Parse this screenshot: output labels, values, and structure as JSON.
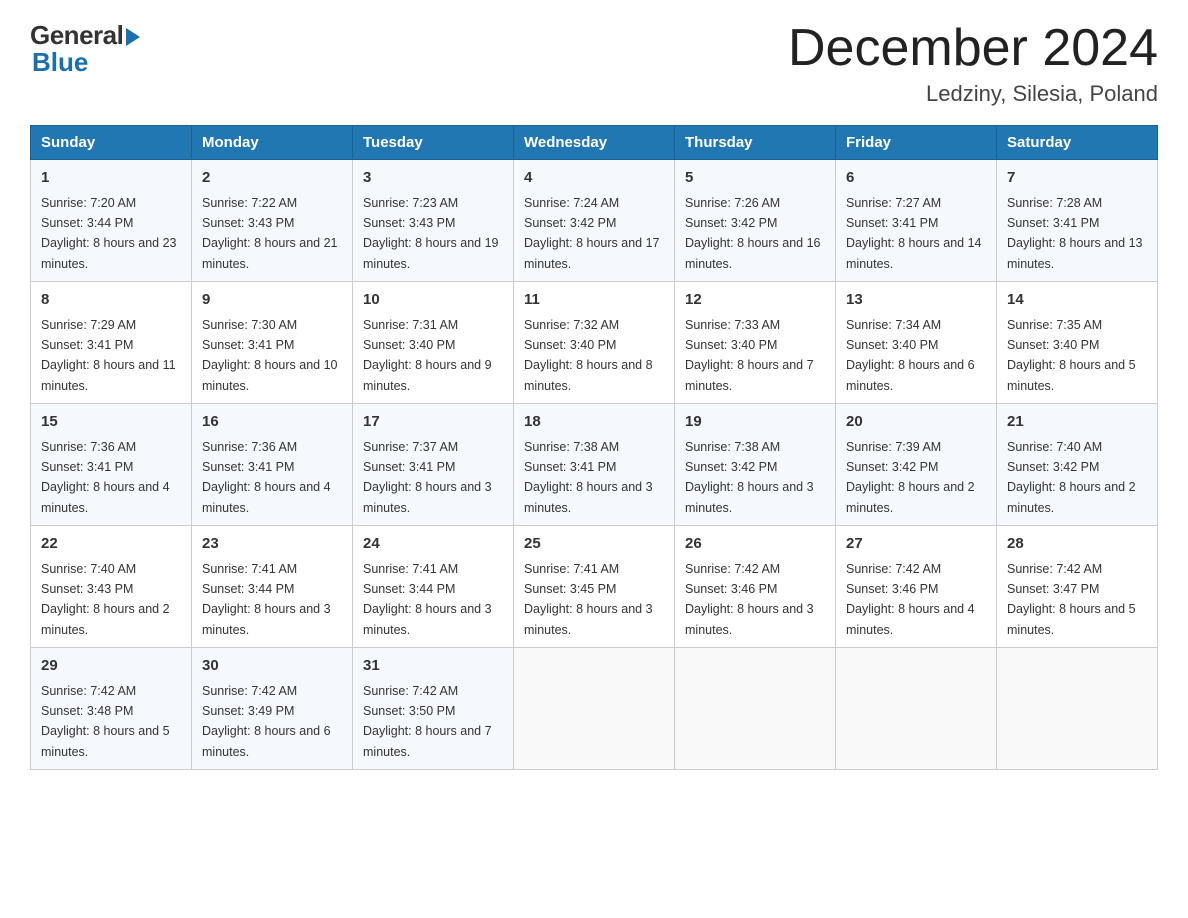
{
  "header": {
    "logo_general": "General",
    "logo_blue": "Blue",
    "month_year": "December 2024",
    "location": "Ledziny, Silesia, Poland"
  },
  "weekdays": [
    "Sunday",
    "Monday",
    "Tuesday",
    "Wednesday",
    "Thursday",
    "Friday",
    "Saturday"
  ],
  "weeks": [
    [
      {
        "day": "1",
        "sunrise": "7:20 AM",
        "sunset": "3:44 PM",
        "daylight": "8 hours and 23 minutes."
      },
      {
        "day": "2",
        "sunrise": "7:22 AM",
        "sunset": "3:43 PM",
        "daylight": "8 hours and 21 minutes."
      },
      {
        "day": "3",
        "sunrise": "7:23 AM",
        "sunset": "3:43 PM",
        "daylight": "8 hours and 19 minutes."
      },
      {
        "day": "4",
        "sunrise": "7:24 AM",
        "sunset": "3:42 PM",
        "daylight": "8 hours and 17 minutes."
      },
      {
        "day": "5",
        "sunrise": "7:26 AM",
        "sunset": "3:42 PM",
        "daylight": "8 hours and 16 minutes."
      },
      {
        "day": "6",
        "sunrise": "7:27 AM",
        "sunset": "3:41 PM",
        "daylight": "8 hours and 14 minutes."
      },
      {
        "day": "7",
        "sunrise": "7:28 AM",
        "sunset": "3:41 PM",
        "daylight": "8 hours and 13 minutes."
      }
    ],
    [
      {
        "day": "8",
        "sunrise": "7:29 AM",
        "sunset": "3:41 PM",
        "daylight": "8 hours and 11 minutes."
      },
      {
        "day": "9",
        "sunrise": "7:30 AM",
        "sunset": "3:41 PM",
        "daylight": "8 hours and 10 minutes."
      },
      {
        "day": "10",
        "sunrise": "7:31 AM",
        "sunset": "3:40 PM",
        "daylight": "8 hours and 9 minutes."
      },
      {
        "day": "11",
        "sunrise": "7:32 AM",
        "sunset": "3:40 PM",
        "daylight": "8 hours and 8 minutes."
      },
      {
        "day": "12",
        "sunrise": "7:33 AM",
        "sunset": "3:40 PM",
        "daylight": "8 hours and 7 minutes."
      },
      {
        "day": "13",
        "sunrise": "7:34 AM",
        "sunset": "3:40 PM",
        "daylight": "8 hours and 6 minutes."
      },
      {
        "day": "14",
        "sunrise": "7:35 AM",
        "sunset": "3:40 PM",
        "daylight": "8 hours and 5 minutes."
      }
    ],
    [
      {
        "day": "15",
        "sunrise": "7:36 AM",
        "sunset": "3:41 PM",
        "daylight": "8 hours and 4 minutes."
      },
      {
        "day": "16",
        "sunrise": "7:36 AM",
        "sunset": "3:41 PM",
        "daylight": "8 hours and 4 minutes."
      },
      {
        "day": "17",
        "sunrise": "7:37 AM",
        "sunset": "3:41 PM",
        "daylight": "8 hours and 3 minutes."
      },
      {
        "day": "18",
        "sunrise": "7:38 AM",
        "sunset": "3:41 PM",
        "daylight": "8 hours and 3 minutes."
      },
      {
        "day": "19",
        "sunrise": "7:38 AM",
        "sunset": "3:42 PM",
        "daylight": "8 hours and 3 minutes."
      },
      {
        "day": "20",
        "sunrise": "7:39 AM",
        "sunset": "3:42 PM",
        "daylight": "8 hours and 2 minutes."
      },
      {
        "day": "21",
        "sunrise": "7:40 AM",
        "sunset": "3:42 PM",
        "daylight": "8 hours and 2 minutes."
      }
    ],
    [
      {
        "day": "22",
        "sunrise": "7:40 AM",
        "sunset": "3:43 PM",
        "daylight": "8 hours and 2 minutes."
      },
      {
        "day": "23",
        "sunrise": "7:41 AM",
        "sunset": "3:44 PM",
        "daylight": "8 hours and 3 minutes."
      },
      {
        "day": "24",
        "sunrise": "7:41 AM",
        "sunset": "3:44 PM",
        "daylight": "8 hours and 3 minutes."
      },
      {
        "day": "25",
        "sunrise": "7:41 AM",
        "sunset": "3:45 PM",
        "daylight": "8 hours and 3 minutes."
      },
      {
        "day": "26",
        "sunrise": "7:42 AM",
        "sunset": "3:46 PM",
        "daylight": "8 hours and 3 minutes."
      },
      {
        "day": "27",
        "sunrise": "7:42 AM",
        "sunset": "3:46 PM",
        "daylight": "8 hours and 4 minutes."
      },
      {
        "day": "28",
        "sunrise": "7:42 AM",
        "sunset": "3:47 PM",
        "daylight": "8 hours and 5 minutes."
      }
    ],
    [
      {
        "day": "29",
        "sunrise": "7:42 AM",
        "sunset": "3:48 PM",
        "daylight": "8 hours and 5 minutes."
      },
      {
        "day": "30",
        "sunrise": "7:42 AM",
        "sunset": "3:49 PM",
        "daylight": "8 hours and 6 minutes."
      },
      {
        "day": "31",
        "sunrise": "7:42 AM",
        "sunset": "3:50 PM",
        "daylight": "8 hours and 7 minutes."
      },
      null,
      null,
      null,
      null
    ]
  ],
  "labels": {
    "sunrise": "Sunrise:",
    "sunset": "Sunset:",
    "daylight": "Daylight:"
  }
}
